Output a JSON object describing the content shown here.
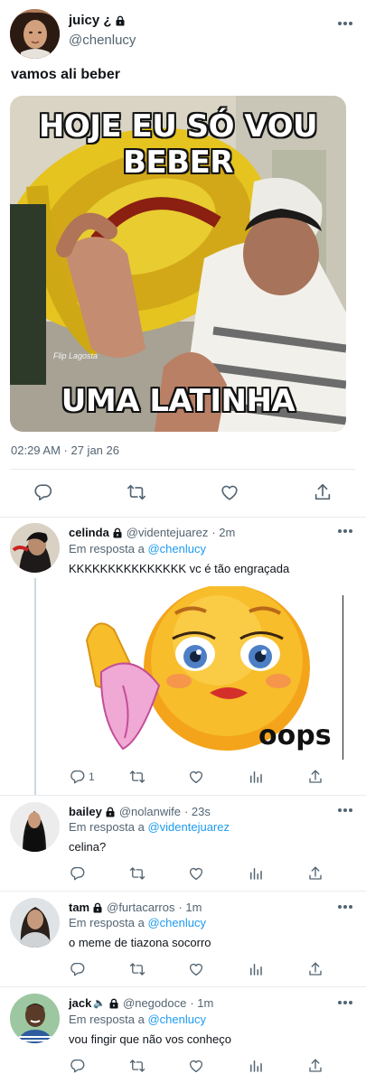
{
  "main_tweet": {
    "display_name": "juicy ¿",
    "handle": "@chenlucy",
    "text": "vamos ali beber",
    "image_caption_top": "HOJE EU SÓ VOU BEBER",
    "image_caption_bottom": "UMA LATINHA",
    "image_watermark": "Flip Lagosta",
    "timestamp": "02:29 AM · 27 jan 26"
  },
  "replies": [
    {
      "display_name": "celinda",
      "handle": "@videntejuarez",
      "time": "· 2m",
      "reply_prefix": "Em resposta a",
      "reply_to": "@chenlucy",
      "text": "KKKKKKKKKKKKKKK vc é tão engraçada",
      "image_caption": "oops",
      "reply_count": "1"
    },
    {
      "display_name": "bailey",
      "handle": "@nolanwife",
      "time": "· 23s",
      "reply_prefix": "Em resposta a",
      "reply_to": "@videntejuarez",
      "text": "celina?"
    },
    {
      "display_name": "tam",
      "handle": "@furtacarros",
      "time": "· 1m",
      "reply_prefix": "Em resposta a",
      "reply_to": "@chenlucy",
      "text": "o meme de tiazona socorro"
    },
    {
      "display_name": "jack",
      "handle": "@negodoce",
      "time": "· 1m",
      "reply_prefix": "Em resposta a",
      "reply_to": "@chenlucy",
      "text": "vou fingir que não vos conheço"
    }
  ],
  "colors": {
    "text": "#0f1419",
    "secondary": "#536471",
    "link": "#1d9bf0",
    "divider": "#e7ecef"
  }
}
